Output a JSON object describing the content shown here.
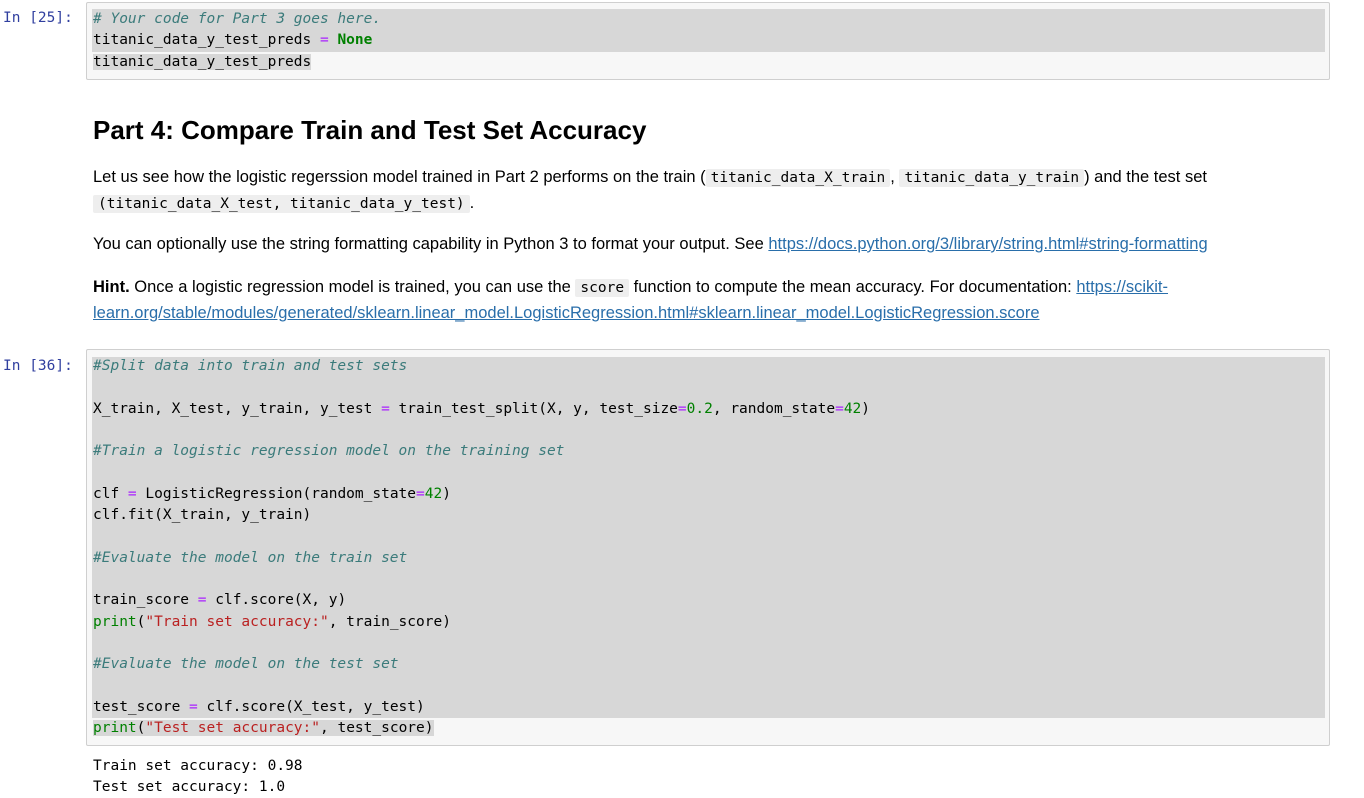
{
  "cell25": {
    "prompt": "In [25]:",
    "comment": "# Your code for Part 3 goes here.",
    "line2_var": "titanic_data_y_test_preds ",
    "line2_op": "=",
    "line2_kw": " None",
    "line3": "titanic_data_y_test_preds"
  },
  "markdown": {
    "heading": "Part 4: Compare Train and Test Set Accuracy",
    "p1_a": "Let us see how the logistic regerssion model trained in Part 2 performs on the train (",
    "p1_code1": "titanic_data_X_train",
    "p1_comma": ",",
    "p1_code2": "titanic_data_y_train",
    "p1_b": ") and the test set",
    "p1_code3": "(titanic_data_X_test, titanic_data_y_test)",
    "p1_end": ".",
    "p2_text": "You can optionally use the string formatting capability in Python 3 to format your output. See ",
    "p2_link": "https://docs.python.org/3/library/string.html#string-formatting",
    "p3_bold": "Hint.",
    "p3_a": " Once a logistic regression model is trained, you can use the ",
    "p3_code": "score",
    "p3_b": " function to compute the mean accuracy. For documentation: ",
    "p3_link1": "https://scikit-",
    "p3_link2": "learn.org/stable/modules/generated/sklearn.linear_model.LogisticRegression.html#sklearn.linear_model.LogisticRegression.score"
  },
  "cell36": {
    "prompt": "In [36]:",
    "c1": "#Split data into train and test sets",
    "l1_a": "X_train, X_test, y_train, y_test ",
    "l1_op": "=",
    "l1_b": " train_test_split(X, y, test_size",
    "l1_op2": "=",
    "l1_n1": "0.2",
    "l1_c": ", random_state",
    "l1_op3": "=",
    "l1_n2": "42",
    "l1_d": ")",
    "c2": "#Train a logistic regression model on the training set",
    "l2_a": "clf ",
    "l2_op": "=",
    "l2_b": " LogisticRegression(random_state",
    "l2_op2": "=",
    "l2_n": "42",
    "l2_c": ")",
    "l3": "clf.fit(X_train, y_train)",
    "c3": "#Evaluate the model on the train set",
    "l4_a": "train_score ",
    "l4_op": "=",
    "l4_b": " clf.score(X, y)",
    "l5_fn": "print",
    "l5_a": "(",
    "l5_str": "\"Train set accuracy:\"",
    "l5_b": ", train_score)",
    "c4": "#Evaluate the model on the test set",
    "l6_a": "test_score ",
    "l6_op": "=",
    "l6_b": " clf.score(X_test, y_test)",
    "l7_fn": "print",
    "l7_a": "(",
    "l7_str": "\"Test set accuracy:\"",
    "l7_b": ", test_score)"
  },
  "output": {
    "line1": "Train set accuracy: 0.98",
    "line2": "Test set accuracy: 1.0"
  }
}
